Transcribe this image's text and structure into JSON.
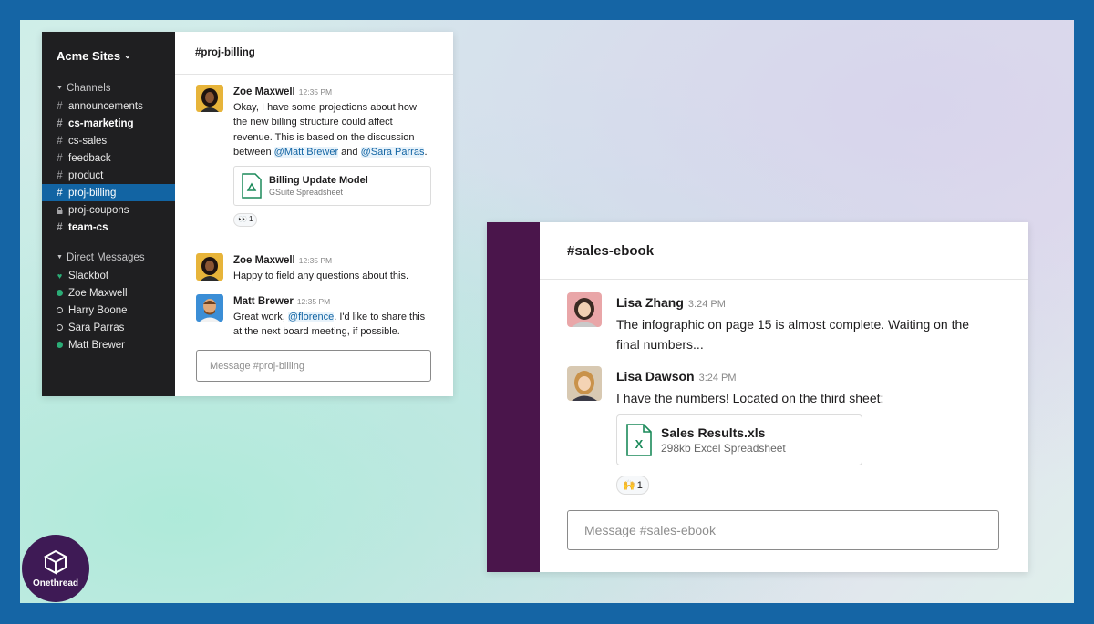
{
  "window1": {
    "workspace": "Acme Sites",
    "channels_header": "Channels",
    "channels": [
      {
        "name": "announcements"
      },
      {
        "name": "cs-marketing"
      },
      {
        "name": "cs-sales"
      },
      {
        "name": "feedback"
      },
      {
        "name": "product"
      },
      {
        "name": "proj-billing"
      },
      {
        "name": "proj-coupons"
      },
      {
        "name": "team-cs"
      }
    ],
    "dm_header": "Direct Messages",
    "dms": [
      {
        "name": "Slackbot"
      },
      {
        "name": "Zoe Maxwell"
      },
      {
        "name": "Harry Boone"
      },
      {
        "name": "Sara Parras"
      },
      {
        "name": "Matt Brewer"
      }
    ],
    "channel_title": "proj-billing",
    "messages": [
      {
        "author": "Zoe Maxwell",
        "time": "12:35 PM",
        "text_a": "Okay, I have some projections about how the new billing structure could affect revenue. This is based on the discussion between ",
        "mention1": "@Matt Brewer",
        "text_b": " and ",
        "mention2": "@Sara Parras",
        "text_c": ".",
        "attachment": {
          "title": "Billing Update Model",
          "subtitle": "GSuite Spreadsheet"
        },
        "reaction_count": "1"
      },
      {
        "author": "Zoe Maxwell",
        "time": "12:35 PM",
        "text": "Happy to field any questions about this."
      },
      {
        "author": "Matt Brewer",
        "time": "12:35 PM",
        "text_a": "Great work, ",
        "mention": "@florence",
        "text_b": ". I'd like to share this at the next board meeting, if possible."
      }
    ],
    "input_placeholder": "Message #proj-billing"
  },
  "window2": {
    "channel_title": "sales-ebook",
    "messages": [
      {
        "author": "Lisa Zhang",
        "time": "3:24 PM",
        "text": "The infographic on page 15 is almost complete. Waiting on the final numbers..."
      },
      {
        "author": "Lisa Dawson",
        "time": "3:24 PM",
        "text": "I have the numbers! Located on the third sheet:",
        "attachment": {
          "title": "Sales Results.xls",
          "subtitle": "298kb Excel Spreadsheet"
        },
        "reaction_count": "1"
      }
    ],
    "input_placeholder": "Message #sales-ebook"
  },
  "logo": {
    "text": "Onethread"
  },
  "colors": {
    "frame": "#1565a5",
    "sidebar": "#1f1f21",
    "active_channel": "#1264a3",
    "aubergine": "#4a154b",
    "presence": "#2bac76",
    "logo_bg": "#3e1a55"
  }
}
